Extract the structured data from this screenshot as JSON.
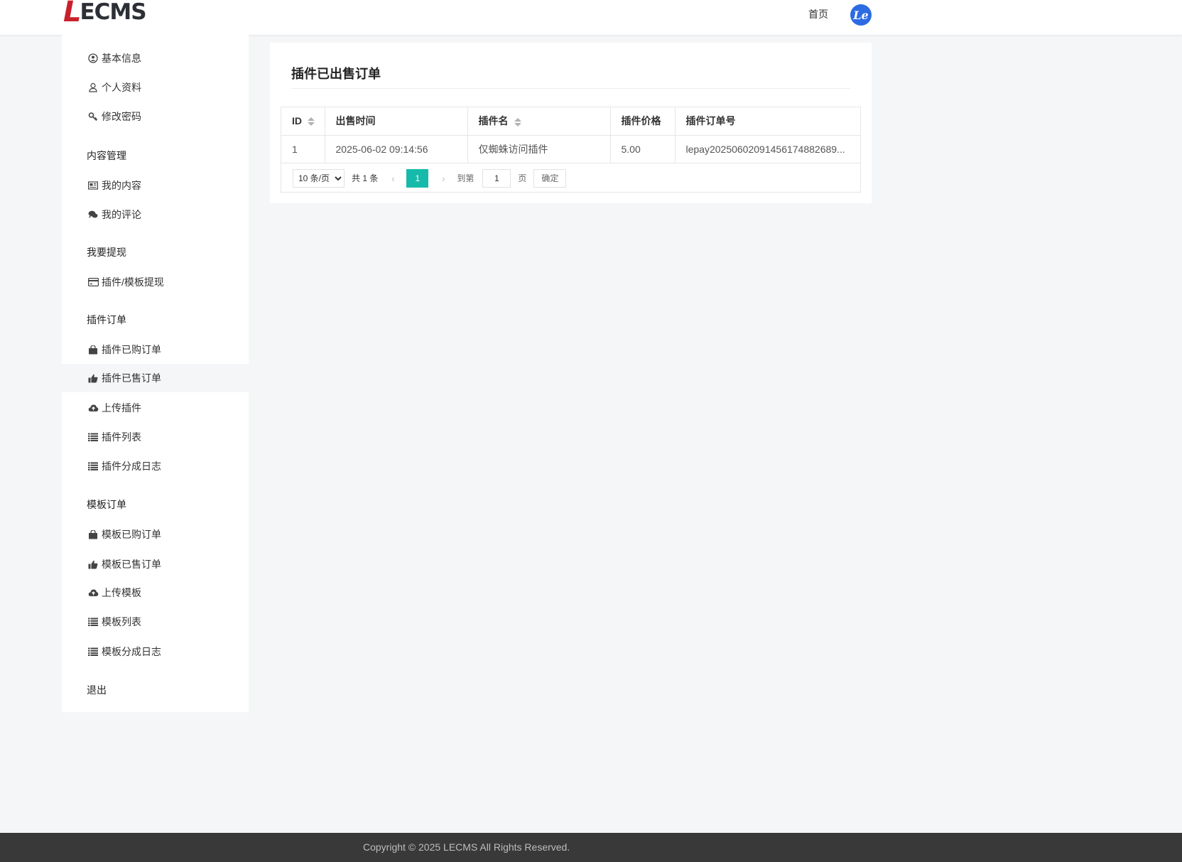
{
  "header": {
    "logo_first": "L",
    "logo_rest": "ECMS",
    "nav_home": "首页",
    "avatar_text": "Le",
    "avatar_color": "#2d6be4"
  },
  "sidebar": {
    "items": [
      {
        "icon": "user-circle-icon",
        "label": "基本信息"
      },
      {
        "icon": "user-icon",
        "label": "个人资料"
      },
      {
        "icon": "key-icon",
        "label": "修改密码"
      },
      {
        "icon": "newspaper-icon",
        "label": "我的内容"
      },
      {
        "icon": "comments-icon",
        "label": "我的评论"
      },
      {
        "icon": "credit-card-icon",
        "label": "插件/模板提现"
      },
      {
        "icon": "shopping-bag-icon",
        "label": "插件已购订单"
      },
      {
        "icon": "thumbs-up-icon",
        "label": "插件已售订单"
      },
      {
        "icon": "cloud-upload-icon",
        "label": "上传插件"
      },
      {
        "icon": "list-icon",
        "label": "插件列表"
      },
      {
        "icon": "list-icon",
        "label": "插件分成日志"
      },
      {
        "icon": "shopping-bag-icon",
        "label": "模板已购订单"
      },
      {
        "icon": "thumbs-up-icon",
        "label": "模板已售订单"
      },
      {
        "icon": "cloud-upload-icon",
        "label": "上传模板"
      },
      {
        "icon": "list-icon",
        "label": "模板列表"
      },
      {
        "icon": "list-icon",
        "label": "模板分成日志"
      }
    ],
    "groups": {
      "content": "内容管理",
      "withdraw": "我要提现",
      "plugin_orders": "插件订单",
      "template_orders": "模板订单",
      "logout": "退出"
    }
  },
  "main": {
    "title": "插件已出售订单",
    "table": {
      "headers": [
        "ID",
        "出售时间",
        "插件名",
        "插件价格",
        "插件订单号"
      ],
      "rows": [
        [
          "1",
          "2025-06-02 09:14:56",
          "仅蜘蛛访问插件",
          "5.00",
          "lepay2025060209145617488268​9..."
        ]
      ]
    },
    "pager": {
      "page_size_option": "10 条/页",
      "total": "共 1 条",
      "current_page": "1",
      "goto_label": "到第",
      "goto_value": "1",
      "page_unit": "页",
      "confirm": "确定",
      "accent": "#16baaa"
    }
  },
  "footer": {
    "copyright": "Copyright © 2025 LECMS All Rights Reserved."
  }
}
